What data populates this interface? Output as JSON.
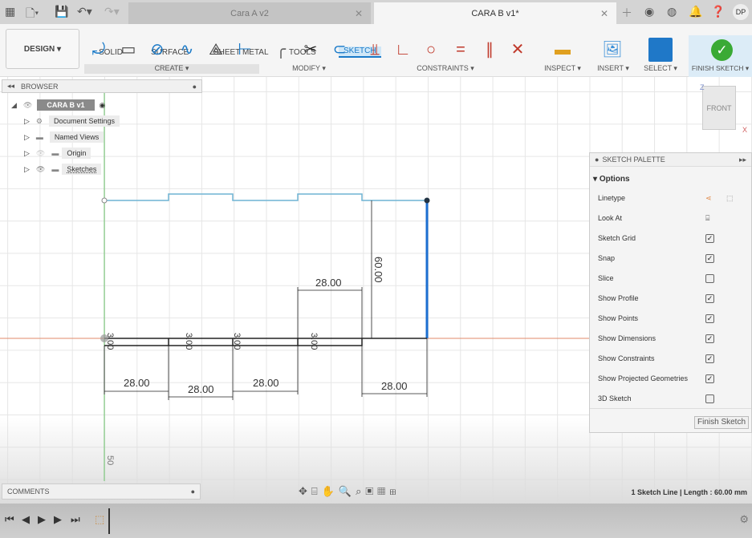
{
  "topbar": {
    "tabs": [
      {
        "label": "Cara A v2",
        "active": false
      },
      {
        "label": "CARA B v1*",
        "active": true
      }
    ],
    "user_initials": "DP"
  },
  "toolbar": {
    "design_label": "DESIGN ▾",
    "workspace_tabs": [
      "SOLID",
      "SURFACE",
      "SHEET METAL",
      "TOOLS",
      "SKETCH"
    ],
    "active_tab": "SKETCH",
    "groups": [
      "CREATE ▾",
      "MODIFY ▾",
      "CONSTRAINTS ▾",
      "INSPECT ▾",
      "INSERT ▾",
      "SELECT ▾",
      "FINISH SKETCH ▾"
    ]
  },
  "browser": {
    "title": "BROWSER",
    "root": "CARA B v1",
    "items": [
      "Document Settings",
      "Named Views",
      "Origin",
      "Sketches"
    ]
  },
  "viewcube": {
    "face": "FRONT",
    "axis_z": "Z",
    "axis_x": "X"
  },
  "sketch": {
    "dimensions": {
      "widths": [
        "28.00",
        "28.00",
        "28.00",
        "28.00",
        "28.00"
      ],
      "height": "60.00",
      "thickness": [
        "3.00",
        "3.00",
        "3.00",
        "3.00"
      ],
      "ruler": "50"
    },
    "colors": {
      "selected": "#1c6fd1",
      "projected": "#6fb4d4",
      "x_axis": "#e08a6a",
      "y_axis": "#6ac26a"
    }
  },
  "palette": {
    "title": "SKETCH PALETTE",
    "section": "Options",
    "options": [
      {
        "label": "Linetype",
        "type": "icons"
      },
      {
        "label": "Look At",
        "type": "icon"
      },
      {
        "label": "Sketch Grid",
        "checked": true
      },
      {
        "label": "Snap",
        "checked": true
      },
      {
        "label": "Slice",
        "checked": false
      },
      {
        "label": "Show Profile",
        "checked": true
      },
      {
        "label": "Show Points",
        "checked": true
      },
      {
        "label": "Show Dimensions",
        "checked": true
      },
      {
        "label": "Show Constraints",
        "checked": true
      },
      {
        "label": "Show Projected Geometries",
        "checked": true
      },
      {
        "label": "3D Sketch",
        "checked": false
      }
    ],
    "finish_label": "Finish Sketch"
  },
  "comments": {
    "title": "COMMENTS"
  },
  "status": {
    "text": "1 Sketch Line | Length : 60.00 mm"
  }
}
